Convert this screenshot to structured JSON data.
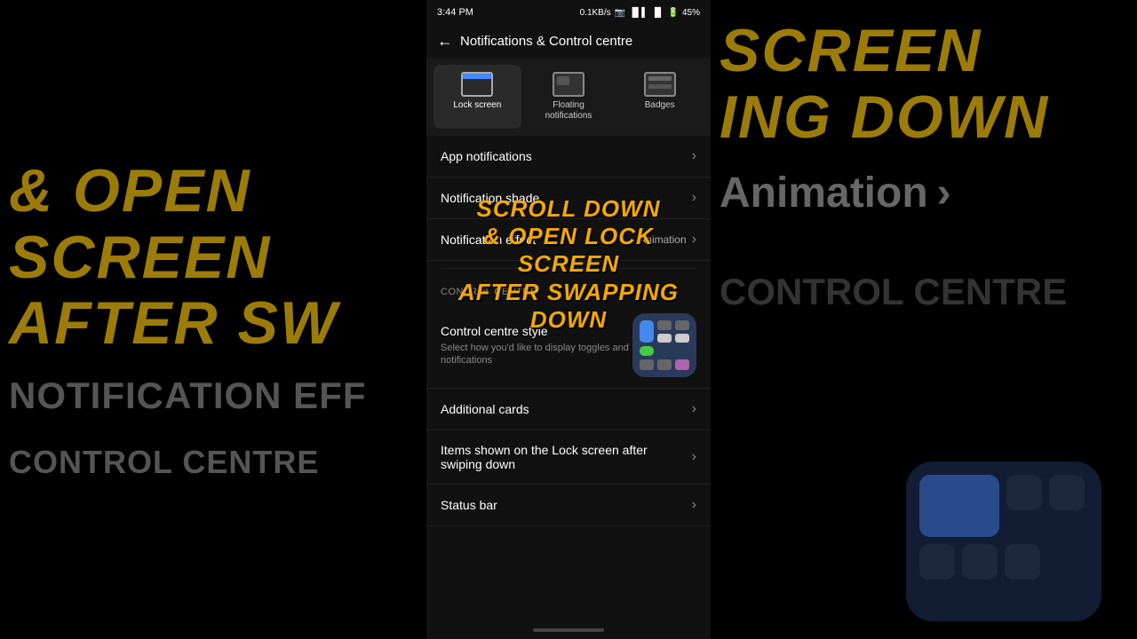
{
  "background": {
    "left_text_line1": "& OPEN",
    "left_text_line2": "SCREEN",
    "left_text_line3": "AFTER SW",
    "left_gray_text": "Notification eff",
    "left_gray_text2": "Control centre",
    "right_text_line1": "SCREEN",
    "right_text_line2": "ING DOWN",
    "right_anim_text": "Animation",
    "right_bottom1": "CONTROL CENTRE"
  },
  "status_bar": {
    "time": "3:44 PM",
    "data_speed": "0.1KB/s",
    "battery": "45%"
  },
  "header": {
    "title": "Notifications & Control centre",
    "back_label": "←"
  },
  "tabs": [
    {
      "id": "lock-screen",
      "label": "Lock screen",
      "active": true
    },
    {
      "id": "floating-notifications",
      "label": "Floating notifications",
      "active": false
    },
    {
      "id": "badges",
      "label": "Badges",
      "active": false
    }
  ],
  "menu_items": [
    {
      "id": "app-notifications",
      "label": "App notifications",
      "right_text": ""
    },
    {
      "id": "notification-shade",
      "label": "Notification shade",
      "right_text": ""
    },
    {
      "id": "notification-effect",
      "label": "Notification effect",
      "right_text": "Animation"
    }
  ],
  "section_label": "CONTROL CENTRE",
  "control_centre_style": {
    "title": "Control centre style",
    "description": "Select how you'd like to display toggles and notifications"
  },
  "additional_items": [
    {
      "id": "additional-cards",
      "label": "Additional cards"
    },
    {
      "id": "items-lock-screen",
      "label": "Items shown on the Lock screen after swiping down"
    },
    {
      "id": "status-bar",
      "label": "Status bar"
    }
  ],
  "overlay_text": "SCROLL DOWN\n& OPEN LOCK SCREEN\nAFTER SWAPPING DOWN"
}
